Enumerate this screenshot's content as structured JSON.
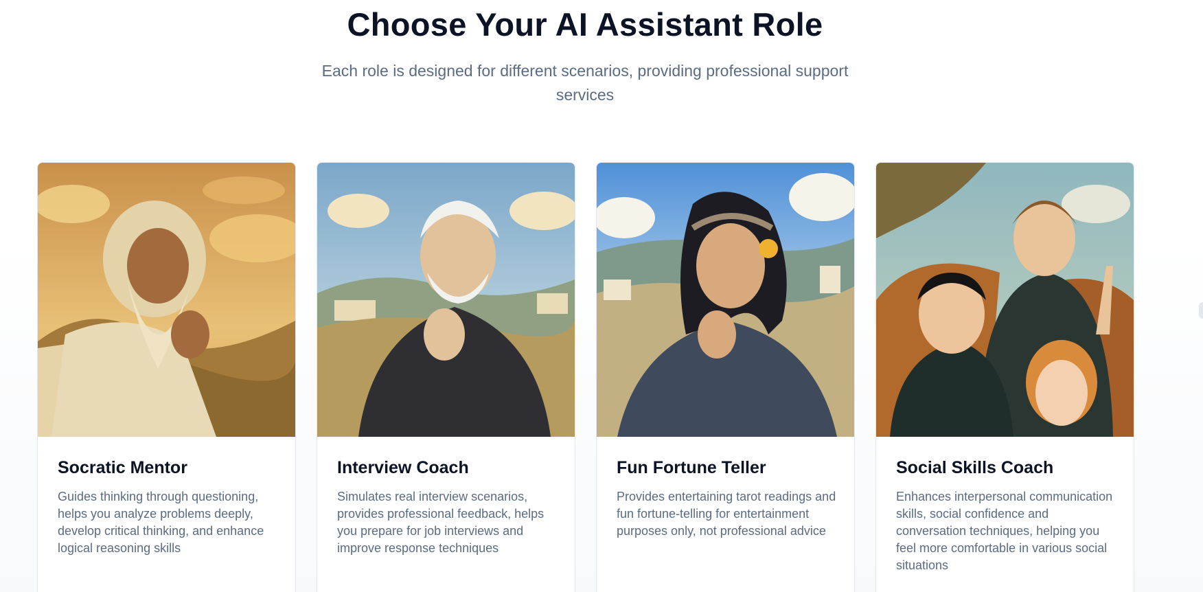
{
  "header": {
    "title": "Choose Your AI Assistant Role",
    "subtitle": "Each role is designed for different scenarios, providing professional support services"
  },
  "roles": [
    {
      "title": "Socratic Mentor",
      "description": "Guides thinking through questioning, helps you analyze problems deeply, develop critical thinking, and enhance logical reasoning skills",
      "image": "elderly-bearded-philosopher-illustration"
    },
    {
      "title": "Interview Coach",
      "description": "Simulates real interview scenarios, provides professional feedback, helps you prepare for job interviews and improve response techniques",
      "image": "white-haired-man-thinking-illustration"
    },
    {
      "title": "Fun Fortune Teller",
      "description": "Provides entertaining tarot readings and fun fortune-telling for entertainment purposes only, not professional advice",
      "image": "young-woman-with-flower-headband-illustration"
    },
    {
      "title": "Social Skills Coach",
      "description": "Enhances interpersonal communication skills, social confidence and conversation techniques, helping you feel more comfortable in various social situations",
      "image": "three-friends-waving-illustration"
    }
  ]
}
